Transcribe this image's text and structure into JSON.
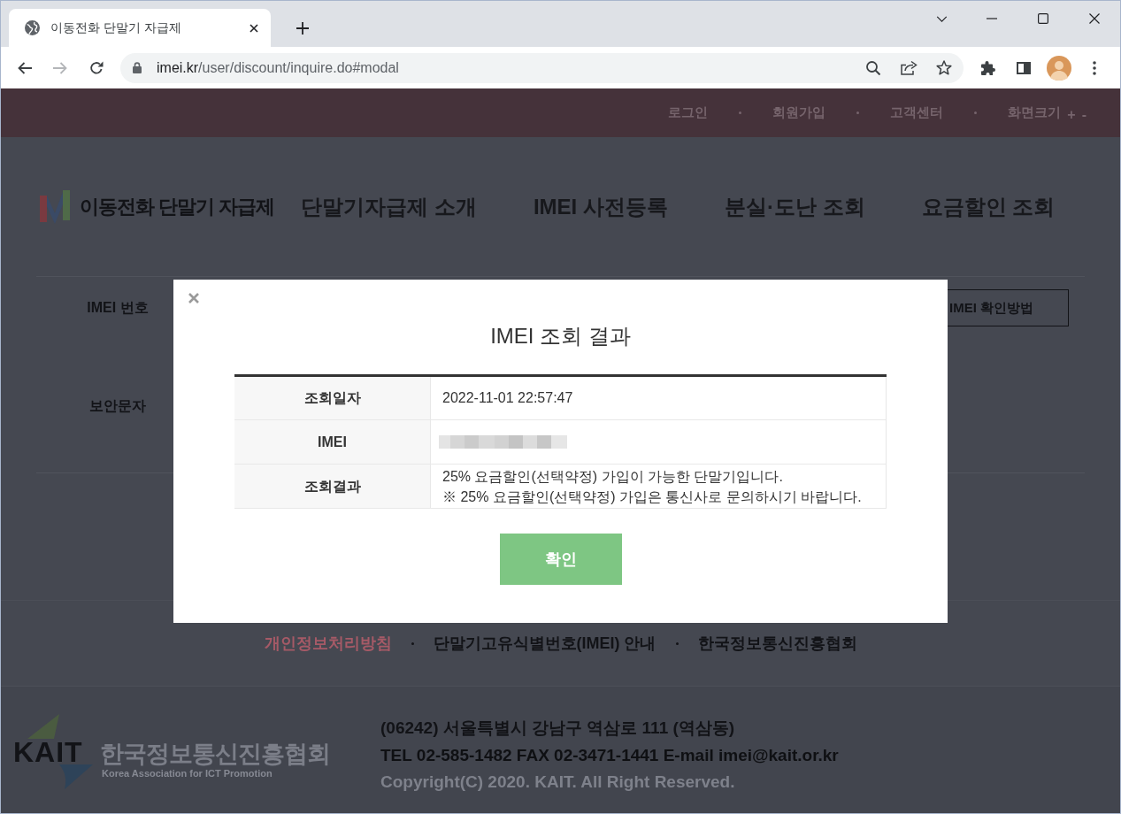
{
  "browser": {
    "tabs": [
      {
        "title": "이동전화 단말기 자급제",
        "selected": true
      }
    ],
    "address_bar": {
      "host": "imei.kr",
      "path": "/user/discount/inquire.do#modal"
    }
  },
  "top_bar": {
    "links": [
      {
        "label": "로그인"
      },
      {
        "label": "회원가입"
      },
      {
        "label": "고객센터"
      }
    ],
    "screen_size": {
      "label": "화면크기",
      "increase": "+",
      "decrease": "-"
    }
  },
  "header": {
    "logo_text": "이동전화 단말기 자급제",
    "nav": [
      {
        "label": "단말기자급제 소개"
      },
      {
        "label": "IMEI 사전등록"
      },
      {
        "label": "분실·도난 조회"
      },
      {
        "label": "요금할인 조회"
      }
    ]
  },
  "form": {
    "fields": [
      {
        "label": "IMEI 번호"
      },
      {
        "label": "보안문자"
      }
    ],
    "help_button": "IMEI 확인방법"
  },
  "modal": {
    "title": "IMEI 조회 결과",
    "rows": [
      {
        "kind": "text",
        "label": "조회일자",
        "value": "2022-11-01 22:57:47"
      },
      {
        "kind": "redacted",
        "label": "IMEI"
      },
      {
        "kind": "lines",
        "label": "조회결과",
        "lines": [
          "25% 요금할인(선택약정) 가입이 가능한 단말기입니다.",
          "※ 25% 요금할인(선택약정) 가입은 통신사로 문의하시기 바랍니다."
        ]
      }
    ],
    "confirm_button": "확인"
  },
  "footer": {
    "links": [
      {
        "label": "개인정보처리방침",
        "emphasized": true
      },
      {
        "label": "단말기고유식별번호(IMEI) 안내",
        "emphasized": false
      },
      {
        "label": "한국정보통신진흥협회",
        "emphasized": false
      }
    ],
    "logo": {
      "abbr": "KAIT",
      "name": "한국정보통신진흥협회",
      "tagline": "Korea Association for ICT Promotion"
    },
    "address": "(06242) 서울특별시 강남구 역삼로 111 (역삼동)",
    "contact": "TEL 02-585-1482 FAX 02-3471-1441 E-mail imei@kait.or.kr",
    "copyright": "Copyright(C) 2020. KAIT. All Right Reserved."
  }
}
